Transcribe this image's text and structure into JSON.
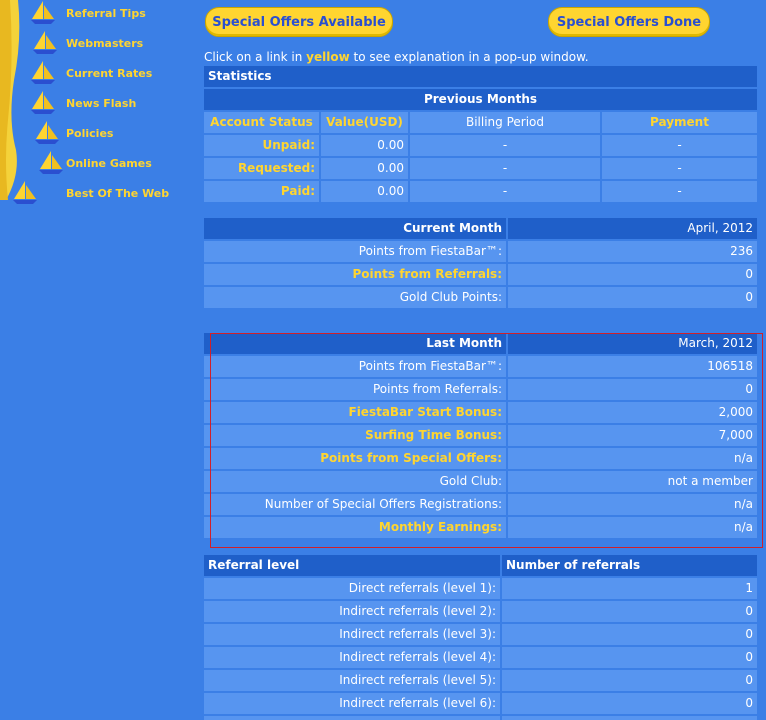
{
  "nav": {
    "items": [
      {
        "label": "Referral Tips"
      },
      {
        "label": "Webmasters"
      },
      {
        "label": "Current Rates"
      },
      {
        "label": "News Flash"
      },
      {
        "label": "Policies"
      },
      {
        "label": "Online Games"
      },
      {
        "label": "Best Of The Web"
      }
    ]
  },
  "buttons": {
    "offers_available": "Special Offers Available",
    "offers_done": "Special Offers Done"
  },
  "info": {
    "before": "Click on a link in ",
    "highlight": "yellow",
    "after": " to see explanation in a pop-up window."
  },
  "statistics": {
    "title": "Statistics",
    "previous_months": "Previous Months",
    "columns": [
      "Account Status",
      "Value(USD)",
      "Billing Period",
      "Payment"
    ],
    "rows": [
      {
        "status": "Unpaid:",
        "value": "0.00",
        "period": "-",
        "payment": "-"
      },
      {
        "status": "Requested:",
        "value": "0.00",
        "period": "-",
        "payment": "-"
      },
      {
        "status": "Paid:",
        "value": "0.00",
        "period": "-",
        "payment": "-"
      }
    ]
  },
  "current_month": {
    "title": "Current Month",
    "date": "April, 2012",
    "rows": [
      {
        "label": "Points from FiestaBar™:",
        "value": "236"
      },
      {
        "label": "Points from Referrals:",
        "value": "0"
      },
      {
        "label": "Gold Club Points:",
        "value": "0"
      }
    ]
  },
  "last_month": {
    "title": "Last Month",
    "date": "March, 2012",
    "rows": [
      {
        "label": "Points from FiestaBar™:",
        "value": "106518"
      },
      {
        "label": "Points from Referrals:",
        "value": "0"
      },
      {
        "label": "FiestaBar Start Bonus:",
        "value": "2,000"
      },
      {
        "label": "Surfing Time Bonus:",
        "value": "7,000"
      },
      {
        "label": "Points from Special Offers:",
        "value": "n/a"
      },
      {
        "label": "Gold Club:",
        "value": "not a member"
      },
      {
        "label": "Number of Special Offers Registrations:",
        "value": "n/a"
      },
      {
        "label": "Monthly Earnings:",
        "value": "n/a"
      }
    ]
  },
  "referrals": {
    "col_level": "Referral level",
    "col_count": "Number of referrals",
    "rows": [
      {
        "label": "Direct referrals (level 1):",
        "value": "1"
      },
      {
        "label": "Indirect referrals (level 2):",
        "value": "0"
      },
      {
        "label": "Indirect referrals (level 3):",
        "value": "0"
      },
      {
        "label": "Indirect referrals (level 4):",
        "value": "0"
      },
      {
        "label": "Indirect referrals (level 5):",
        "value": "0"
      },
      {
        "label": "Indirect referrals (level 6):",
        "value": "0"
      }
    ]
  },
  "colors": {
    "background": "#3b7fe6",
    "header": "#1f5fc9",
    "cell": "#5795f0",
    "accent_yellow": "#ffd530",
    "selection_border": "#d0202a"
  }
}
